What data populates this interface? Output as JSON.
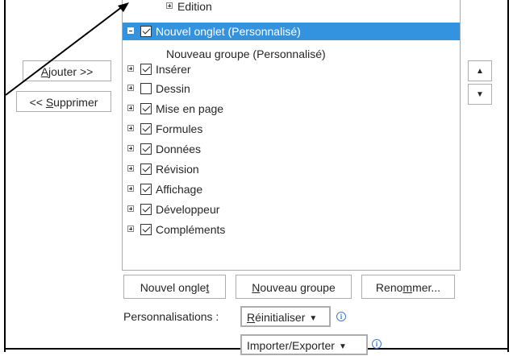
{
  "buttons": {
    "add": {
      "accel": "A",
      "rest": "jouter >>"
    },
    "remove": {
      "prefix": "<< ",
      "accel": "S",
      "rest": "upprimer"
    }
  },
  "tree": {
    "top_partial": {
      "label": "Edition",
      "expander": "plus"
    },
    "items": [
      {
        "label": "Nouvel onglet (Personnalisé)",
        "expander": "minus",
        "checked": true,
        "selected": true
      },
      {
        "label": "Nouveau groupe (Personnalisé)",
        "group": true
      },
      {
        "label": "Insérer",
        "expander": "plus",
        "checked": true
      },
      {
        "label": "Dessin",
        "expander": "plus",
        "checked": false
      },
      {
        "label": "Mise en page",
        "expander": "plus",
        "checked": true
      },
      {
        "label": "Formules",
        "expander": "plus",
        "checked": true
      },
      {
        "label": "Données",
        "expander": "plus",
        "checked": true
      },
      {
        "label": "Révision",
        "expander": "plus",
        "checked": true
      },
      {
        "label": "Affichage",
        "expander": "plus",
        "checked": true
      },
      {
        "label": "Développeur",
        "expander": "plus",
        "checked": true
      },
      {
        "label": "Compléments",
        "expander": "plus",
        "checked": true
      }
    ]
  },
  "bottom_buttons": {
    "new_tab": {
      "pre": "Nouvel ongle",
      "accel": "t",
      "post": ""
    },
    "new_group": {
      "pre": "",
      "accel": "N",
      "post": "ouveau groupe"
    },
    "rename": {
      "pre": "Reno",
      "accel": "m",
      "post": "mer..."
    }
  },
  "customizations": {
    "label": "Personnalisations :",
    "reset": {
      "accel": "R",
      "rest": "éinitialiser"
    },
    "import_export": "Importer/Exporter"
  },
  "icons": {
    "move_up": "▲",
    "move_down": "▼",
    "caret": "▼",
    "info": "i"
  }
}
